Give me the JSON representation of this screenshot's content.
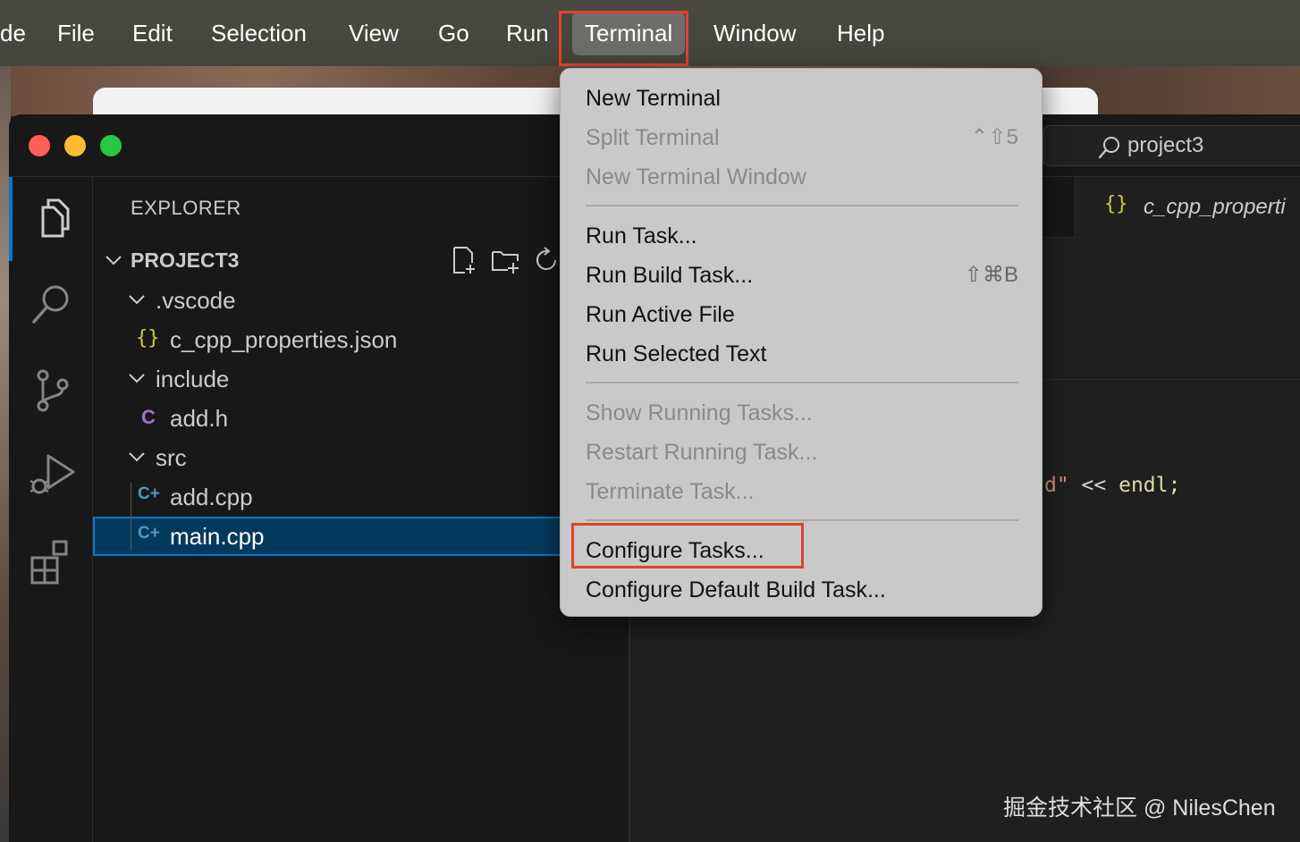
{
  "menubar": {
    "app_partial": "de",
    "items": [
      "File",
      "Edit",
      "Selection",
      "View",
      "Go",
      "Run",
      "Terminal",
      "Window",
      "Help"
    ],
    "active_item": "Terminal"
  },
  "search": {
    "label": "project3"
  },
  "explorer": {
    "title": "EXPLORER",
    "project": "PROJECT3",
    "tree": [
      {
        "name": ".vscode",
        "type": "folder"
      },
      {
        "name": "c_cpp_properties.json",
        "type": "json",
        "icon": "{}"
      },
      {
        "name": "include",
        "type": "folder"
      },
      {
        "name": "add.h",
        "type": "c-header",
        "icon": "C"
      },
      {
        "name": "src",
        "type": "folder"
      },
      {
        "name": "add.cpp",
        "type": "cpp",
        "icon": "C+"
      },
      {
        "name": "main.cpp",
        "type": "cpp",
        "icon": "C+",
        "selected": true
      }
    ]
  },
  "editor": {
    "tab_label": "c_cpp_properti",
    "tab_icon": "{}",
    "code_fragment": {
      "str": "d\"",
      "op": " << ",
      "id": "endl;"
    }
  },
  "terminal_menu": {
    "items": [
      {
        "label": "New Terminal",
        "enabled": true,
        "shortcut": ""
      },
      {
        "label": "Split Terminal",
        "enabled": false,
        "shortcut": "⌃⇧5"
      },
      {
        "label": "New Terminal Window",
        "enabled": false,
        "shortcut": ""
      },
      {
        "label": "Run Task...",
        "enabled": true,
        "shortcut": ""
      },
      {
        "label": "Run Build Task...",
        "enabled": true,
        "shortcut": "⇧⌘B"
      },
      {
        "label": "Run Active File",
        "enabled": true,
        "shortcut": ""
      },
      {
        "label": "Run Selected Text",
        "enabled": true,
        "shortcut": ""
      },
      {
        "label": "Show Running Tasks...",
        "enabled": false,
        "shortcut": ""
      },
      {
        "label": "Restart Running Task...",
        "enabled": false,
        "shortcut": ""
      },
      {
        "label": "Terminate Task...",
        "enabled": false,
        "shortcut": ""
      },
      {
        "label": "Configure Tasks...",
        "enabled": true,
        "shortcut": "",
        "highlighted": true
      },
      {
        "label": "Configure Default Build Task...",
        "enabled": true,
        "shortcut": ""
      }
    ]
  },
  "watermark": "掘金技术社区 @ NilesChen",
  "colors": {
    "highlight": "#e2412d",
    "selection": "#04395e",
    "accent": "#0078d4",
    "json_icon": "#cbcb41",
    "c_icon": "#a074c4",
    "cpp_icon": "#519aba"
  }
}
